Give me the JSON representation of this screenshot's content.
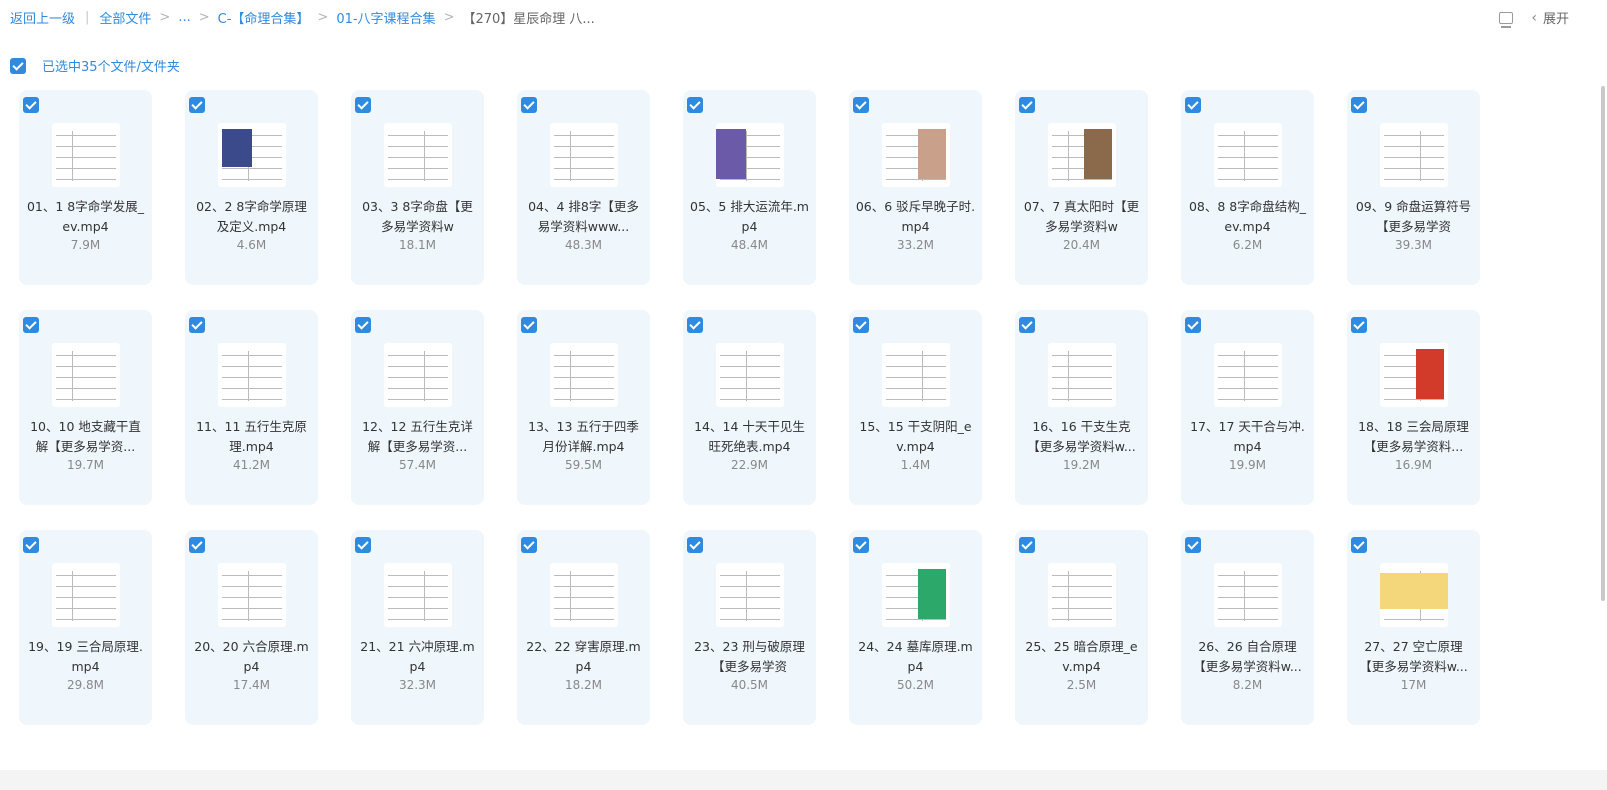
{
  "breadcrumb": {
    "back": "返回上一级",
    "all_files": "全部文件",
    "ellipsis": "...",
    "c_folder": "C-【命理合集】",
    "bazi_folder": "01-八字课程合集",
    "current": "【270】星辰命理 八..."
  },
  "toolbar": {
    "expand_label": "展开",
    "list_icon": "list-view-icon",
    "collapse_icon": "chevron-left-icon"
  },
  "selection": {
    "label": "已选中35个文件/文件夹"
  },
  "colors": {
    "accent": "#2f8ae0",
    "card_bg": "#eff7fd"
  },
  "files": [
    {
      "name": "01、1 8字命学发展_ev.mp4",
      "size": "7.9M"
    },
    {
      "name": "02、2 8字命学原理及定义.mp4",
      "size": "4.6M"
    },
    {
      "name": "03、3 8字命盘【更多易学资料w",
      "size": "18.1M"
    },
    {
      "name": "04、4 排8字【更多易学资料www...",
      "size": "48.3M"
    },
    {
      "name": "05、5 排大运流年.mp4",
      "size": "48.4M"
    },
    {
      "name": "06、6 驳斥早晚子时.mp4",
      "size": "33.2M"
    },
    {
      "name": "07、7 真太阳时【更多易学资料w",
      "size": "20.4M"
    },
    {
      "name": "08、8 8字命盘结构_ev.mp4",
      "size": "6.2M"
    },
    {
      "name": "09、9 命盘运算符号【更多易学资",
      "size": "39.3M"
    },
    {
      "name": "10、10 地支藏干直解【更多易学资...",
      "size": "19.7M"
    },
    {
      "name": "11、11 五行生克原理.mp4",
      "size": "41.2M"
    },
    {
      "name": "12、12 五行生克详解【更多易学资...",
      "size": "57.4M"
    },
    {
      "name": "13、13 五行于四季月份详解.mp4",
      "size": "59.5M"
    },
    {
      "name": "14、14 十天干见生旺死绝表.mp4",
      "size": "22.9M"
    },
    {
      "name": "15、15 干支阴阳_ev.mp4",
      "size": "1.4M"
    },
    {
      "name": "16、16 干支生克【更多易学资料w...",
      "size": "19.2M"
    },
    {
      "name": "17、17 天干合与冲.mp4",
      "size": "19.9M"
    },
    {
      "name": "18、18 三会局原理【更多易学资料...",
      "size": "16.9M"
    },
    {
      "name": "19、19 三合局原理.mp4",
      "size": "29.8M"
    },
    {
      "name": "20、20 六合原理.mp4",
      "size": "17.4M"
    },
    {
      "name": "21、21 六冲原理.mp4",
      "size": "32.3M"
    },
    {
      "name": "22、22 穿害原理.mp4",
      "size": "18.2M"
    },
    {
      "name": "23、23 刑与破原理【更多易学资",
      "size": "40.5M"
    },
    {
      "name": "24、24 墓库原理.mp4",
      "size": "50.2M"
    },
    {
      "name": "25、25 暗合原理_ev.mp4",
      "size": "2.5M"
    },
    {
      "name": "26、26 自合原理【更多易学资料w...",
      "size": "8.2M"
    },
    {
      "name": "27、27 空亡原理【更多易学资料w...",
      "size": "17M"
    }
  ]
}
